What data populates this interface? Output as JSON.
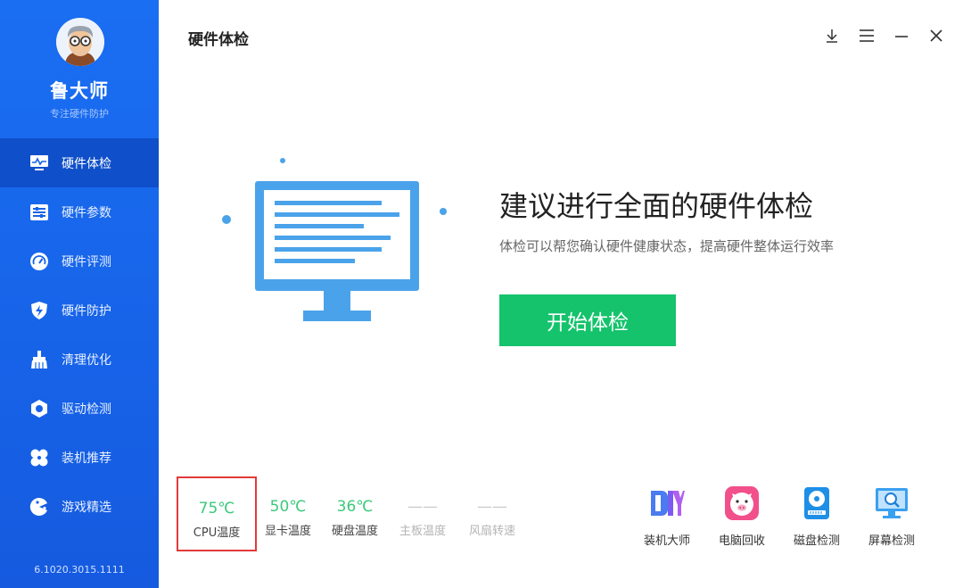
{
  "app": {
    "name": "鲁大师",
    "slogan": "专注硬件防护",
    "version": "6.1020.3015.1111"
  },
  "sidebar": {
    "items": [
      {
        "label": "硬件体检",
        "icon": "monitor-pulse-icon",
        "active": true
      },
      {
        "label": "硬件参数",
        "icon": "sliders-icon"
      },
      {
        "label": "硬件评测",
        "icon": "speedometer-icon"
      },
      {
        "label": "硬件防护",
        "icon": "shield-bolt-icon"
      },
      {
        "label": "清理优化",
        "icon": "broom-icon"
      },
      {
        "label": "驱动检测",
        "icon": "hexagon-nut-icon"
      },
      {
        "label": "装机推荐",
        "icon": "four-petal-icon"
      },
      {
        "label": "游戏精选",
        "icon": "pacman-icon"
      }
    ]
  },
  "header": {
    "title": "硬件体检",
    "controls": [
      "download-icon",
      "menu-icon",
      "minimize-icon",
      "close-icon"
    ]
  },
  "hero": {
    "title": "建议进行全面的硬件体检",
    "subtitle": "体检可以帮您确认硬件健康状态，提高硬件整体运行效率",
    "button": "开始体检"
  },
  "stats": [
    {
      "value": "75℃",
      "label": "CPU温度",
      "state": "ok"
    },
    {
      "value": "50℃",
      "label": "显卡温度",
      "state": "ok"
    },
    {
      "value": "36℃",
      "label": "硬盘温度",
      "state": "ok"
    },
    {
      "value": "——",
      "label": "主板温度",
      "state": "na"
    },
    {
      "value": "——",
      "label": "风扇转速",
      "state": "na"
    }
  ],
  "tools": [
    {
      "label": "装机大师",
      "icon": "diy-icon"
    },
    {
      "label": "电脑回收",
      "icon": "pig-icon"
    },
    {
      "label": "磁盘检测",
      "icon": "disk-icon"
    },
    {
      "label": "屏幕检测",
      "icon": "screen-search-icon"
    }
  ],
  "colors": {
    "sidebar": "#1a6ef2",
    "sidebar_active": "#0f4fc9",
    "accent_green": "#14c36b",
    "temp_green": "#3bc97c",
    "highlight_red": "#e23a3a",
    "illustration_blue": "#4aa3ea"
  }
}
